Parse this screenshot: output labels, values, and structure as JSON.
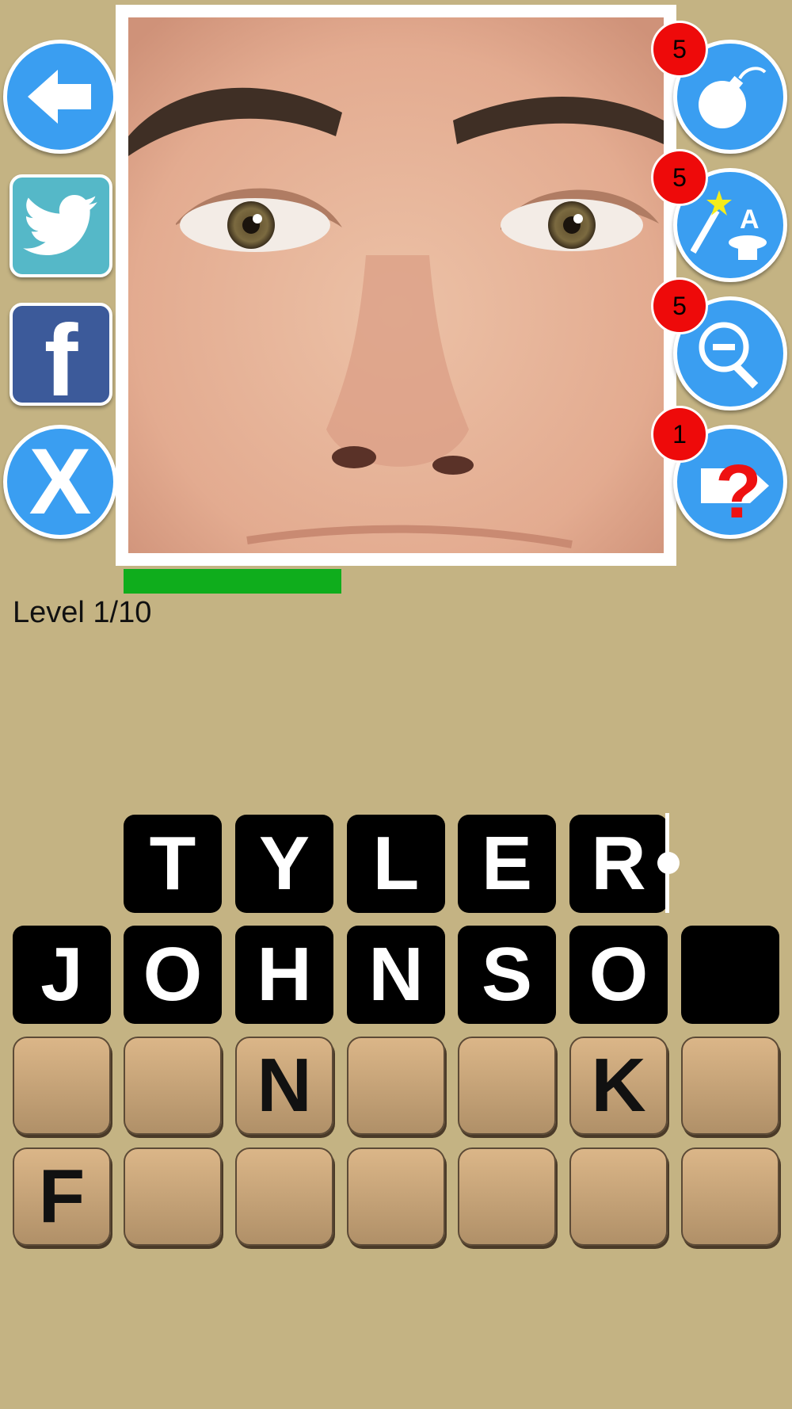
{
  "level": {
    "label": "Level 1/10",
    "progress": 0.35
  },
  "left_buttons": [
    {
      "name": "back-button",
      "icon": "back-arrow-icon",
      "color": "#3a9ef1"
    },
    {
      "name": "twitter-button",
      "icon": "twitter-bird-icon",
      "color": "#55b8c8"
    },
    {
      "name": "facebook-button",
      "icon": "facebook-icon",
      "color": "#3c5a9a",
      "label": "f"
    },
    {
      "name": "close-button",
      "icon": "close-icon",
      "label": "X"
    }
  ],
  "hints": [
    {
      "name": "bomb-hint",
      "icon": "bomb-icon",
      "count": "5"
    },
    {
      "name": "magic-letter-hint",
      "icon": "magic-wand-hat-icon",
      "count": "5"
    },
    {
      "name": "zoom-out-hint",
      "icon": "zoom-out-icon",
      "count": "5"
    },
    {
      "name": "skip-hint",
      "icon": "question-skip-icon",
      "count": "1"
    }
  ],
  "answer": {
    "row1": [
      "T",
      "Y",
      "L",
      "E",
      "R"
    ],
    "row2": [
      "J",
      "O",
      "H",
      "N",
      "S",
      "O",
      ""
    ]
  },
  "letter_pool": {
    "row1": [
      "",
      "",
      "N",
      "",
      "",
      "K",
      ""
    ],
    "row2": [
      "F",
      "",
      "",
      "",
      "",
      "",
      ""
    ]
  },
  "colors": {
    "background": "#c4b383",
    "button_blue": "#3a9ef1",
    "badge_red": "#ee0a0a",
    "progress_green": "#0fad1c"
  }
}
